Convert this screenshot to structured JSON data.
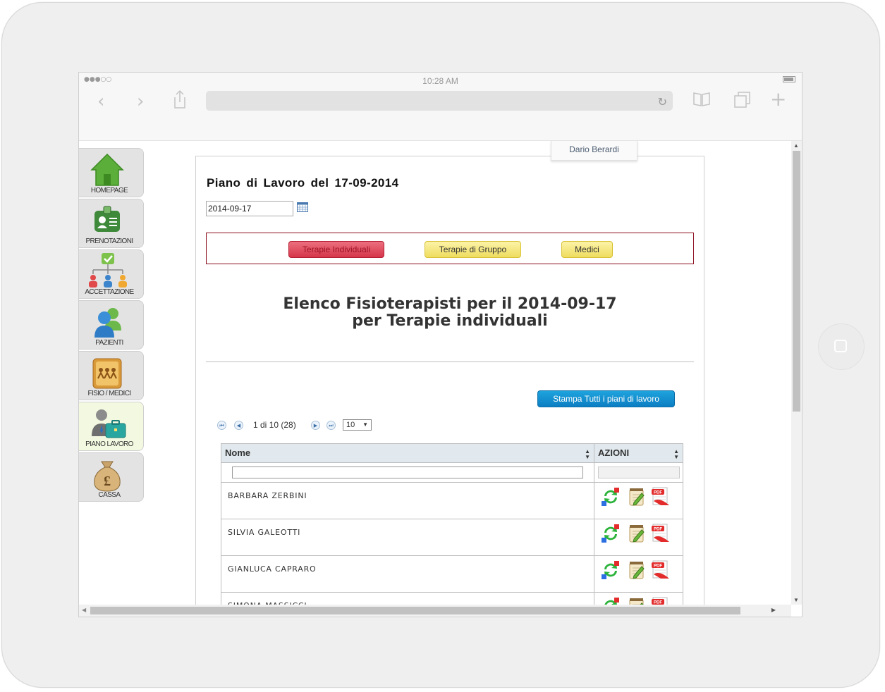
{
  "status_bar": {
    "signal": "●●●○○",
    "time": "10:28 AM"
  },
  "user": {
    "name": "Dario Berardi"
  },
  "sidebar": {
    "items": [
      {
        "label": "HOMEPAGE",
        "icon": "home-icon"
      },
      {
        "label": "PRENOTAZIONI",
        "icon": "id-card-icon"
      },
      {
        "label": "ACCETTAZIONE",
        "icon": "org-chart-icon"
      },
      {
        "label": "PAZIENTI",
        "icon": "patients-icon"
      },
      {
        "label": "FISIO / MEDICI",
        "icon": "staff-icon"
      },
      {
        "label": "PIANO LAVORO",
        "icon": "briefcase-user-icon",
        "active": true
      },
      {
        "label": "CASSA",
        "icon": "money-bag-icon"
      }
    ]
  },
  "page": {
    "title": "Piano di Lavoro del 17-09-2014",
    "date_value": "2014-09-17"
  },
  "filters": {
    "individual": "Terapie Individuali",
    "group": "Terapie di Gruppo",
    "doctors": "Medici"
  },
  "list_title": {
    "line1": "Elenco Fisioterapisti per il 2014-09-17",
    "line2": "per Terapie individuali"
  },
  "print_all": "Stampa Tutti i piani di lavoro",
  "pager": {
    "info": "1 di 10 (28)",
    "rows_per_page": "10"
  },
  "table": {
    "headers": {
      "name": "Nome",
      "actions": "AZIONI"
    },
    "rows": [
      {
        "name": "BARBARA ZERBINI"
      },
      {
        "name": "SILVIA GALEOTTI"
      },
      {
        "name": "GIANLUCA CAPRARO"
      },
      {
        "name": "SIMONA MASSICCI"
      }
    ]
  },
  "colors": {
    "active_filter": "#d63549",
    "filter_yellow": "#efdd5e",
    "print_button": "#0c7ec3",
    "filter_border": "#8b0d1d"
  }
}
